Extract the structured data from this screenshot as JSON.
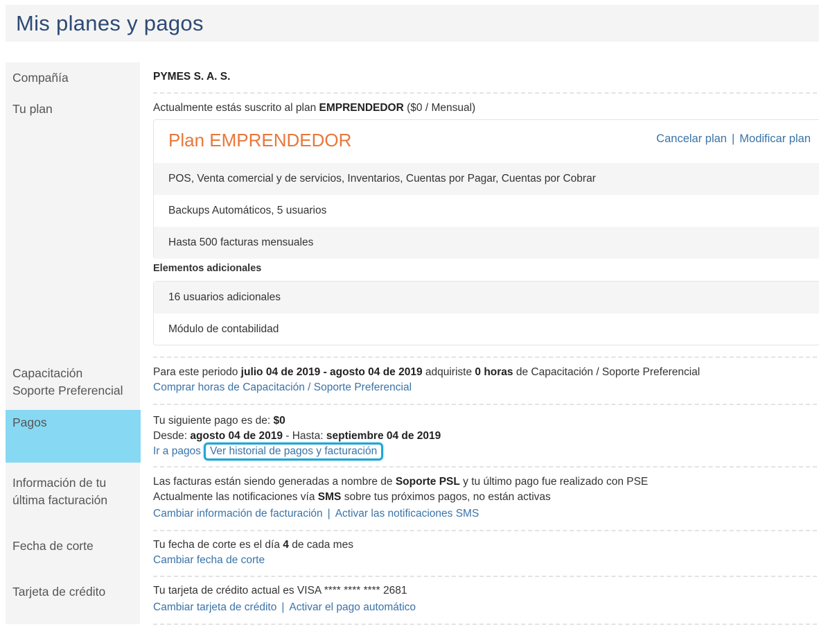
{
  "page": {
    "title": "Mis planes y pagos"
  },
  "sidebar": {
    "company": "Compañía",
    "plan": "Tu plan",
    "training_line1": "Capacitación",
    "training_line2": "Soporte Preferencial",
    "payments": "Pagos",
    "billing_line1": "Información de tu",
    "billing_line2": "última facturación",
    "cutoff": "Fecha de corte",
    "card": "Tarjeta de crédito"
  },
  "company": {
    "name": "PYMES S. A. S."
  },
  "plan": {
    "subscribed_prefix": "Actualmente estás suscrito al plan ",
    "subscribed_plan": "EMPRENDEDOR",
    "subscribed_suffix": " ($0 / Mensual)",
    "box_title": "Plan EMPRENDEDOR",
    "cancel_link": "Cancelar plan",
    "modify_link": "Modificar plan",
    "separator": "|",
    "features": [
      "POS, Venta comercial y de servicios, Inventarios, Cuentas por Pagar, Cuentas por Cobrar",
      "Backups Automáticos, 5 usuarios",
      "Hasta 500 facturas mensuales"
    ],
    "extras_title": "Elementos adicionales",
    "extras": [
      "16 usuarios adicionales",
      "Módulo de contabilidad"
    ]
  },
  "training": {
    "text_1": "Para este periodo ",
    "period": "julio 04 de 2019 - agosto 04 de 2019",
    "text_2": " adquiriste ",
    "hours": "0 horas",
    "text_3": " de Capacitación / Soporte Preferencial",
    "buy_link": "Comprar horas de Capacitación / Soporte Preferencial"
  },
  "payments": {
    "next_prefix": "Tu siguiente pago es de: ",
    "next_amount": "$0",
    "from_label": "Desde: ",
    "from_date": "agosto 04 de 2019",
    "to_label": " - Hasta: ",
    "to_date": "septiembre 04 de 2019",
    "go_link": "Ir a pagos",
    "history_link": "Ver historial de pagos y facturación"
  },
  "billing": {
    "text_1": "Las facturas están siendo generadas a nombre de ",
    "name": "Soporte PSL",
    "text_2": " y tu último pago fue realizado con PSE",
    "sms_1": "Actualmente las notificaciones vía ",
    "sms_bold": "SMS",
    "sms_2": " sobre tus próximos pagos, no están activas",
    "change_link": "Cambiar información de facturación",
    "activate_sms_link": "Activar las notificaciones SMS"
  },
  "cutoff": {
    "text_1": "Tu fecha de corte es el día ",
    "day": "4",
    "text_2": " de cada mes",
    "change_link": "Cambiar fecha de corte"
  },
  "card": {
    "text": "Tu tarjeta de crédito actual es VISA **** **** **** 2681",
    "change_link": "Cambiar tarjeta de crédito",
    "auto_pay_link": "Activar el pago automático"
  },
  "colors": {
    "title_blue": "#2c4a74",
    "link_blue": "#3a73a8",
    "plan_orange": "#e8773a",
    "active_side": "#87d8f3",
    "highlight_border": "#1fa6d8"
  }
}
